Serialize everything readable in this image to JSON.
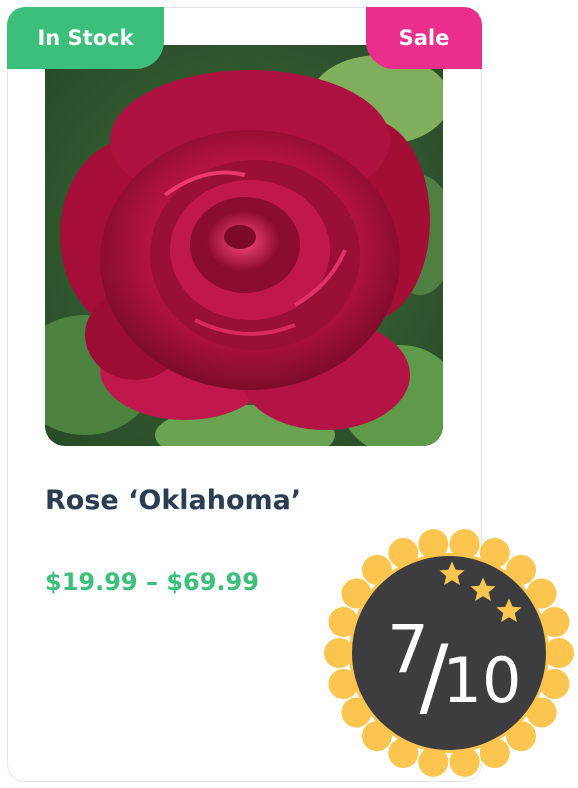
{
  "product": {
    "badge_stock": "In Stock",
    "badge_sale": "Sale",
    "image_alt": "Red rose flower",
    "title": "Rose ‘Oklahoma’",
    "price": "$19.99 – $69.99"
  },
  "rating": {
    "numerator": "7",
    "denominator": "10",
    "stars": 3
  },
  "colors": {
    "in_stock": "#3bbf7a",
    "sale": "#ea2e8c",
    "title": "#2a3d52",
    "price": "#3bbf7a",
    "rating_badge_outer": "#fbc54f",
    "rating_badge_inner": "#3d3d3f",
    "rating_star": "#fbc54f"
  }
}
